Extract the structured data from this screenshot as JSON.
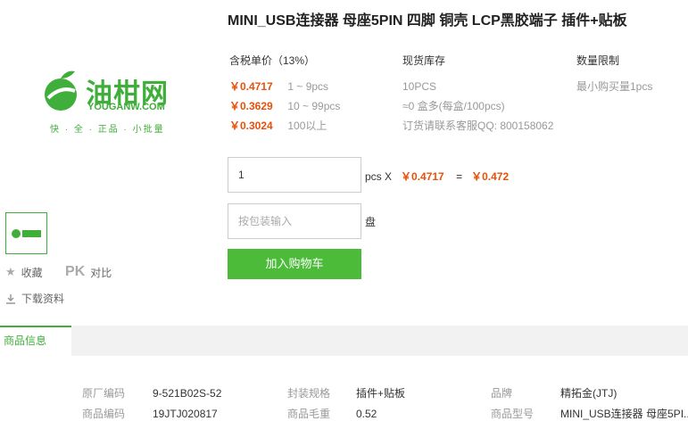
{
  "product": {
    "title": "MINI_USB连接器 母座5PIN 四脚 铜壳 LCP黑胶端子 插件+贴板"
  },
  "logo": {
    "name": "油柑网",
    "domain": "YOUGANW.COM",
    "slogan": "快 · 全 · 正品 · 小批量"
  },
  "side": {
    "favorite_label": "收藏",
    "pk_label": "PK",
    "compare_label": "对比",
    "download_label": "下载资料"
  },
  "pricing": {
    "header": "含税单价（13%）",
    "tiers": [
      {
        "price": "￥0.4717",
        "qty": "1 ~ 9pcs"
      },
      {
        "price": "￥0.3629",
        "qty": "10 ~ 99pcs"
      },
      {
        "price": "￥0.3024",
        "qty": "100以上"
      }
    ]
  },
  "stock": {
    "header": "现货库存",
    "count": "10PCS",
    "pack": "≈0 盒多(每盒/100pcs)",
    "contact": "订货请联系客服QQ: 800158062"
  },
  "limit": {
    "header": "数量限制",
    "min": "最小购买量1pcs"
  },
  "order": {
    "qty_value": "1",
    "unit_label": "pcs X",
    "unit_price": "￥0.4717",
    "equals": "=",
    "total": "￥0.472",
    "pack_placeholder": "按包装输入",
    "pack_unit": "盘",
    "buy_label": "加入购物车"
  },
  "tabs": {
    "info_label": "商品信息"
  },
  "specs": {
    "mfr_code_label": "原厂编码",
    "mfr_code": "9-521B02S-52",
    "package_label": "封装规格",
    "package": "插件+贴板",
    "brand_label": "品牌",
    "brand": "精拓金(JTJ)",
    "item_code_label": "商品编码",
    "item_code": "19JTJ020817",
    "weight_label": "商品毛重",
    "weight": "0.52",
    "model_label": "商品型号",
    "model": "MINI_USB连接器 母座5PI..."
  },
  "colors": {
    "brand_green": "#3fae3a",
    "price_orange": "#e8500a",
    "button_green": "#4cbb39"
  }
}
